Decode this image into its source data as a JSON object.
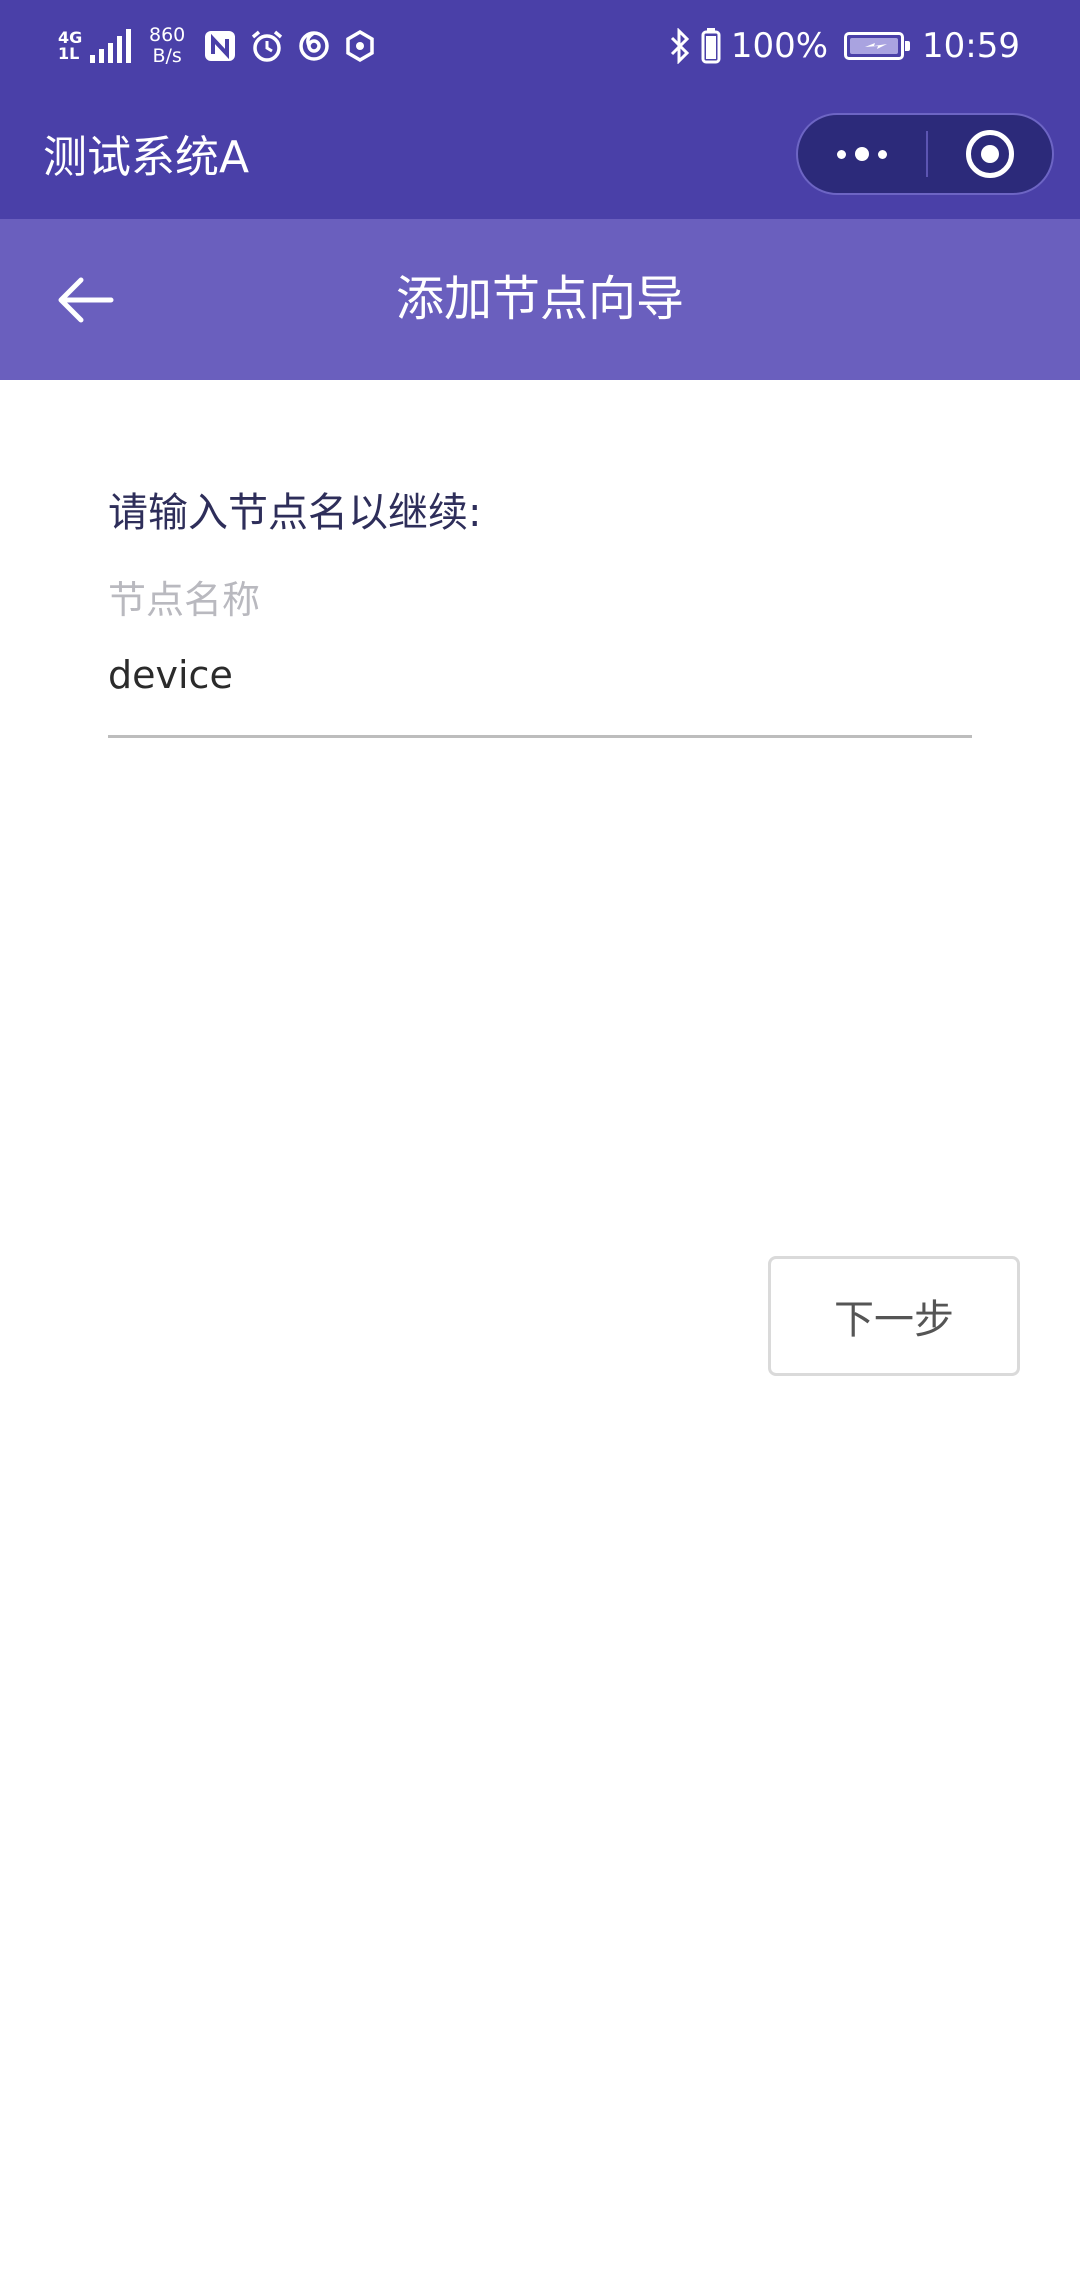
{
  "status_bar": {
    "network": "4G",
    "network_sub": "1L",
    "speed_value": "860",
    "speed_unit": "B/s",
    "bluetooth_percent": "100%",
    "battery_level": 1.0,
    "time": "10:59",
    "icons": [
      "signal-icon",
      "nfc-icon",
      "alarm-icon",
      "swirl-icon",
      "hexagon-icon",
      "bluetooth-icon",
      "phone-battery-icon",
      "battery-icon"
    ]
  },
  "app_bar": {
    "title": "测试系统A",
    "menu_icon": "more-dots-icon",
    "close_icon": "exit-circle-icon"
  },
  "page_header": {
    "back_icon": "arrow-left-icon",
    "title": "添加节点向导"
  },
  "form": {
    "prompt": "请输入节点名以继续:",
    "field_label": "节点名称",
    "field_value": "device"
  },
  "actions": {
    "next_label": "下一步"
  },
  "colors": {
    "top_bar": "#4a40a8",
    "page_header": "#6a5fbe",
    "capsule": "#2c2a7a",
    "text_dark": "#2e2e5a",
    "placeholder": "#b9b9bf"
  }
}
